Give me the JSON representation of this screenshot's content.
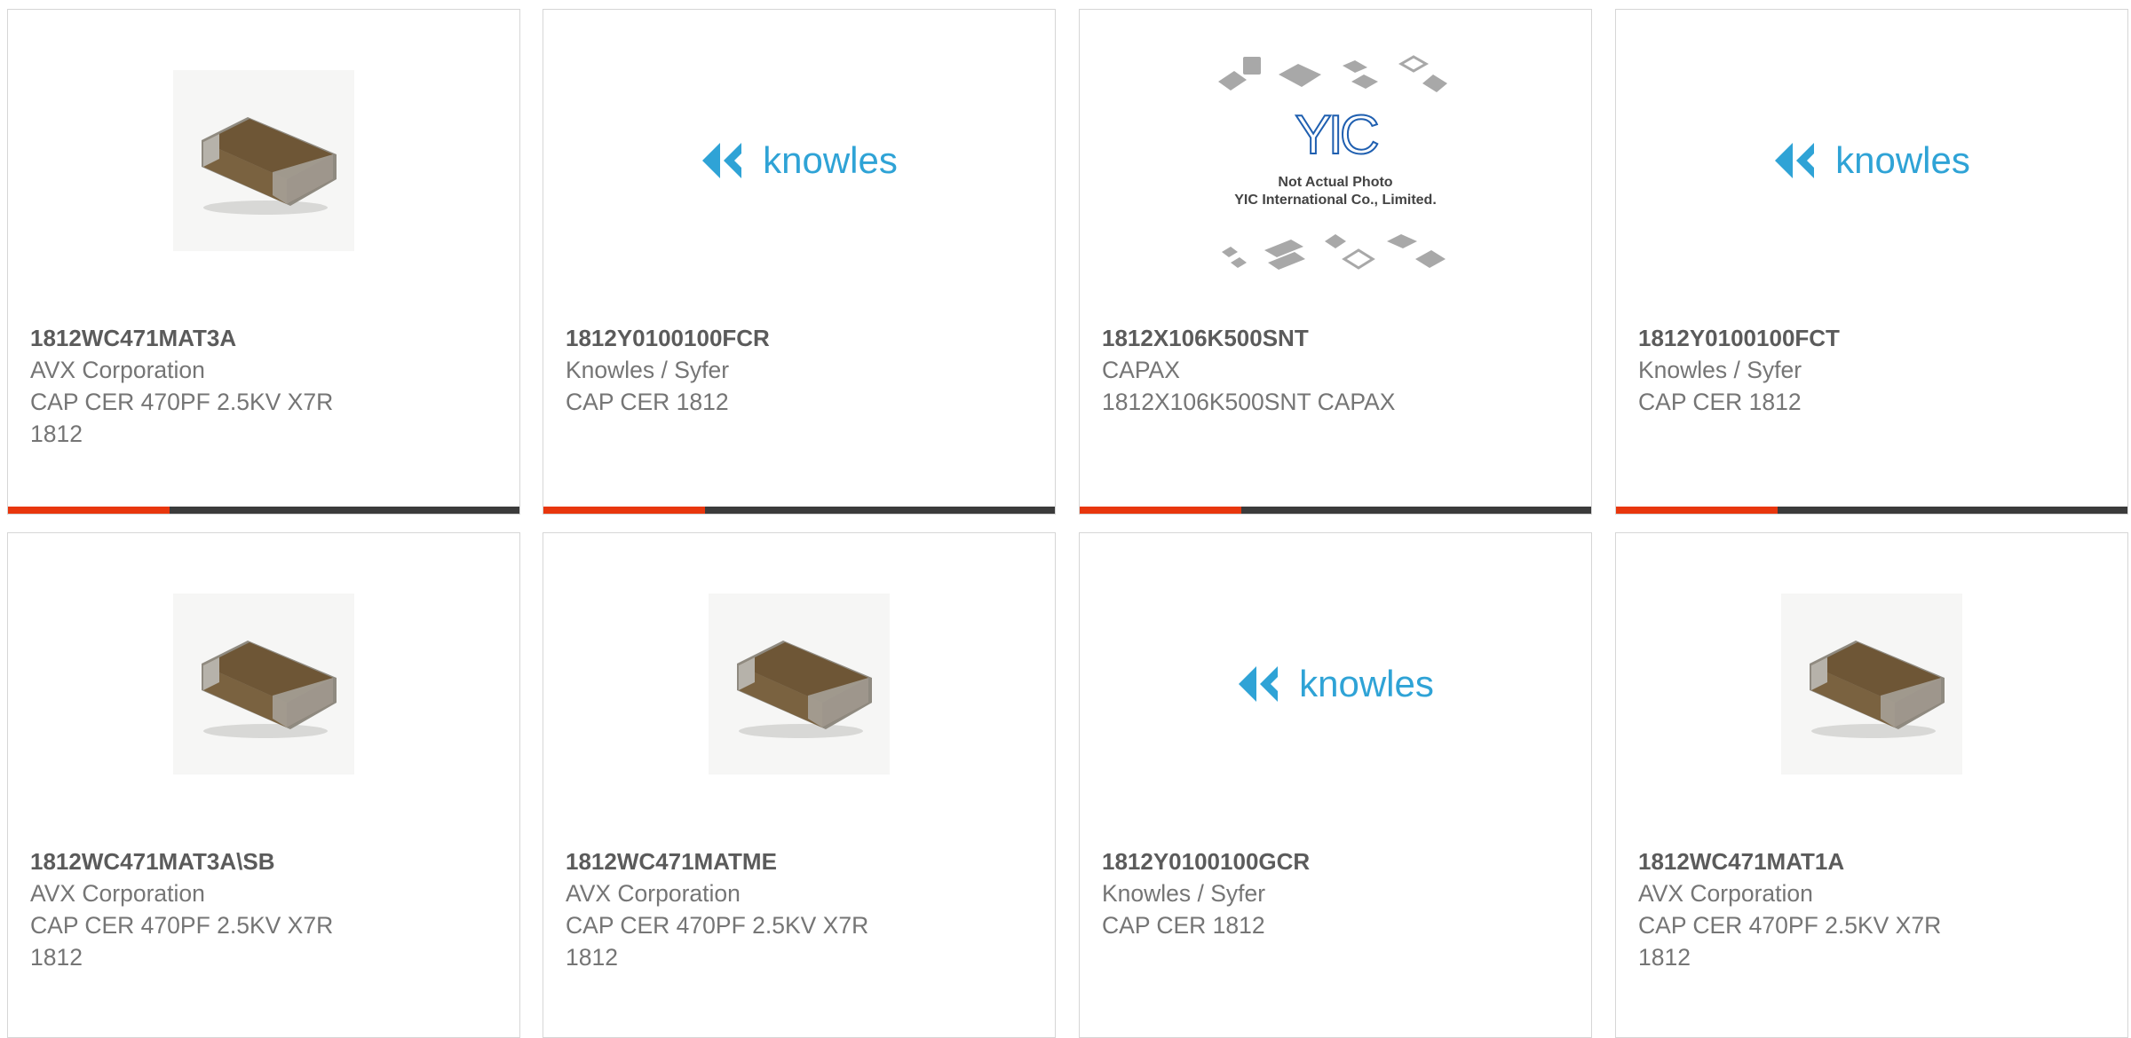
{
  "accent_color": "#e8360d",
  "bar_color": "#3b3b3b",
  "products": [
    {
      "part_number": "1812WC471MAT3A",
      "manufacturer": "AVX Corporation",
      "description": "CAP CER 470PF 2.5KV X7R 1812",
      "image": "ceramic-chip-image"
    },
    {
      "part_number": "1812Y0100100FCR",
      "manufacturer": "Knowles / Syfer",
      "description": "CAP CER 1812",
      "image": "knowles-logo",
      "logo_text": "knowles"
    },
    {
      "part_number": "1812X106K500SNT",
      "manufacturer": "CAPAX",
      "description": "1812X106K500SNT CAPAX",
      "image": "yic-placeholder-image",
      "image_text_1": "YIC",
      "image_text_2": "Not Actual Photo",
      "image_text_3": "YIC International Co., Limited."
    },
    {
      "part_number": "1812Y0100100FCT",
      "manufacturer": "Knowles / Syfer",
      "description": "CAP CER 1812",
      "image": "knowles-logo",
      "logo_text": "knowles"
    },
    {
      "part_number": "1812WC471MAT3A\\SB",
      "manufacturer": "AVX Corporation",
      "description": "CAP CER 470PF 2.5KV X7R 1812",
      "image": "ceramic-chip-image"
    },
    {
      "part_number": "1812WC471MATME",
      "manufacturer": "AVX Corporation",
      "description": "CAP CER 470PF 2.5KV X7R 1812",
      "image": "ceramic-chip-image"
    },
    {
      "part_number": "1812Y0100100GCR",
      "manufacturer": "Knowles / Syfer",
      "description": "CAP CER 1812",
      "image": "knowles-logo",
      "logo_text": "knowles"
    },
    {
      "part_number": "1812WC471MAT1A",
      "manufacturer": "AVX Corporation",
      "description": "CAP CER 470PF 2.5KV X7R 1812",
      "image": "ceramic-chip-image"
    }
  ]
}
